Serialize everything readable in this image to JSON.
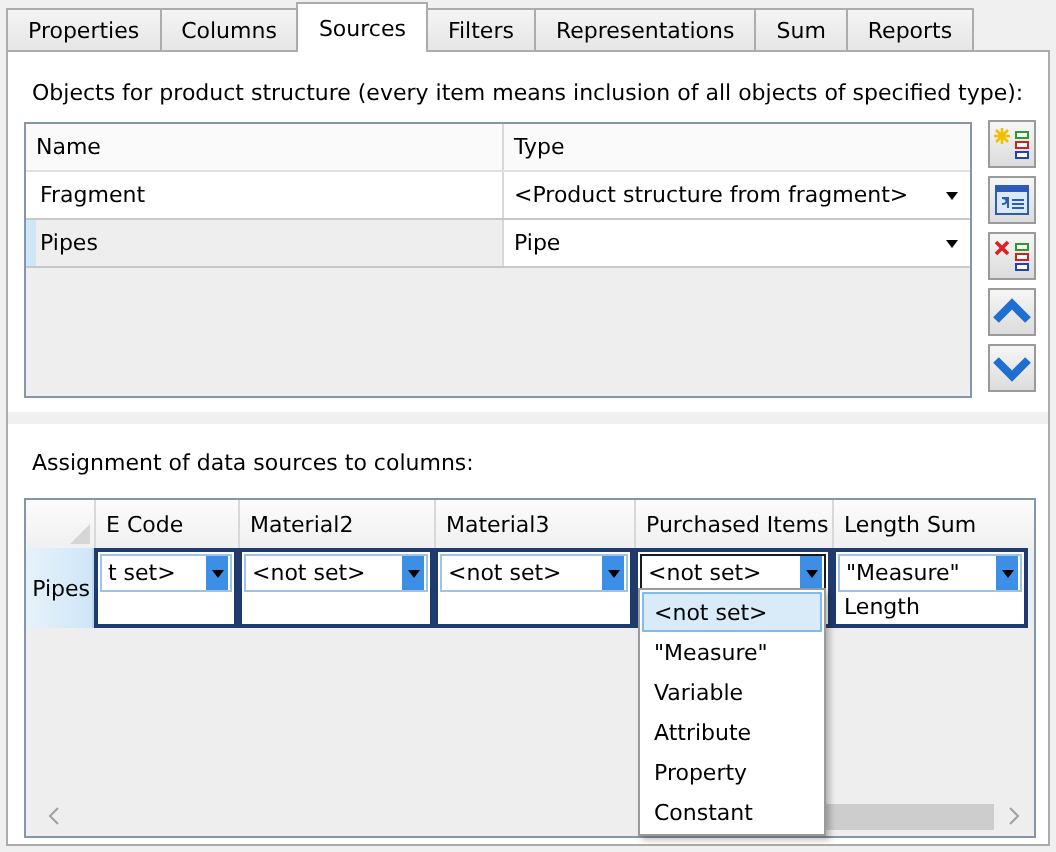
{
  "tabs": [
    {
      "label": "Properties",
      "selected": false
    },
    {
      "label": "Columns",
      "selected": false
    },
    {
      "label": "Sources",
      "selected": true
    },
    {
      "label": "Filters",
      "selected": false
    },
    {
      "label": "Representations",
      "selected": false
    },
    {
      "label": "Sum",
      "selected": false
    },
    {
      "label": "Reports",
      "selected": false
    }
  ],
  "product_structure": {
    "label": "Objects for product structure (every item means inclusion of all objects of specified type):",
    "columns": [
      "Name",
      "Type"
    ],
    "rows": [
      {
        "name": "Fragment",
        "type": "<Product structure from fragment>",
        "selected": false
      },
      {
        "name": "Pipes",
        "type": "Pipe",
        "selected": true
      }
    ],
    "toolbar": [
      {
        "kind": "add"
      },
      {
        "kind": "properties"
      },
      {
        "kind": "delete"
      },
      {
        "kind": "up"
      },
      {
        "kind": "down"
      }
    ]
  },
  "assignment": {
    "label": "Assignment of data sources to columns:",
    "columns": [
      "E Code",
      "Material2",
      "Material3",
      "Purchased Items",
      "Length Sum"
    ],
    "rows": [
      {
        "header": "Pipes",
        "cells": [
          {
            "source": "t set>",
            "open": false
          },
          {
            "source": "<not set>",
            "open": false
          },
          {
            "source": "<not set>",
            "open": false
          },
          {
            "source": "<not set>",
            "open": true
          },
          {
            "source": "\"Measure\"",
            "value": "Length",
            "open": false
          }
        ]
      }
    ],
    "dropdown_options": [
      {
        "label": "<not set>",
        "selected": true
      },
      {
        "label": "\"Measure\"",
        "selected": false
      },
      {
        "label": "Variable",
        "selected": false
      },
      {
        "label": "Attribute",
        "selected": false
      },
      {
        "label": "Property",
        "selected": false
      },
      {
        "label": "Constant",
        "selected": false
      }
    ]
  }
}
